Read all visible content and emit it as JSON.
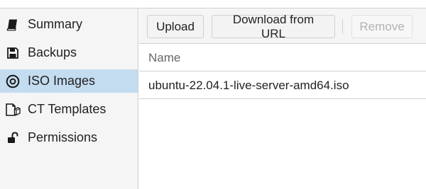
{
  "sidebar": {
    "items": [
      {
        "label": "Summary",
        "icon": "book-icon",
        "active": false
      },
      {
        "label": "Backups",
        "icon": "floppy-disk-icon",
        "active": false
      },
      {
        "label": "ISO Images",
        "icon": "disc-icon",
        "active": true
      },
      {
        "label": "CT Templates",
        "icon": "container-template-icon",
        "active": false
      },
      {
        "label": "Permissions",
        "icon": "unlock-icon",
        "active": false
      }
    ]
  },
  "toolbar": {
    "upload_label": "Upload",
    "download_url_label": "Download from URL",
    "remove_label": "Remove"
  },
  "grid": {
    "columns": [
      "Name"
    ],
    "rows": [
      {
        "name": "ubuntu-22.04.1-live-server-amd64.iso"
      }
    ]
  },
  "colors": {
    "active_background": "#c4dcf0",
    "sidebar_background": "#f5f5f5",
    "border": "#cfcfcf"
  }
}
